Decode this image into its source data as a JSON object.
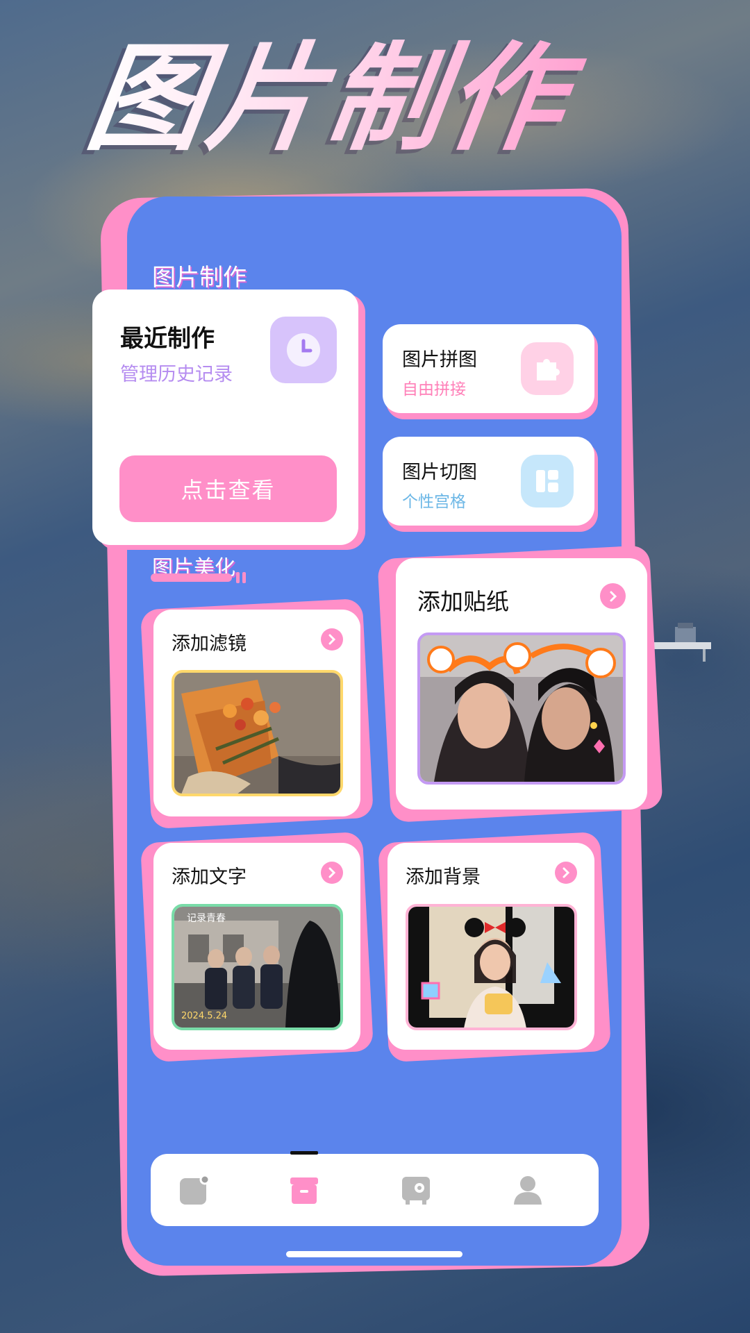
{
  "hero": {
    "title": "图片制作"
  },
  "colors": {
    "accent_pink": "#ff8fc8",
    "panel_blue": "#5b84ec",
    "purple_text": "#b58cf0",
    "blue_text": "#6cb7e6"
  },
  "sections": {
    "make": {
      "title": "图片制作"
    },
    "beautify": {
      "title": "图片美化"
    }
  },
  "recent": {
    "title": "最近制作",
    "subtitle": "管理历史记录",
    "button_label": "点击查看",
    "icon": "clock-icon"
  },
  "collage": {
    "title": "图片拼图",
    "subtitle": "自由拼接",
    "icon": "puzzle-icon"
  },
  "cut": {
    "title": "图片切图",
    "subtitle": "个性宫格",
    "icon": "grid-icon"
  },
  "beautify_cards": [
    {
      "title": "添加滤镜",
      "icon": "chevron-right-icon"
    },
    {
      "title": "添加贴纸",
      "icon": "chevron-right-icon"
    },
    {
      "title": "添加文字",
      "icon": "chevron-right-icon",
      "photo_caption": "记录青春",
      "photo_date": "2024.5.24"
    },
    {
      "title": "添加背景",
      "icon": "chevron-right-icon"
    }
  ],
  "tabbar": {
    "tabs": [
      {
        "icon": "image-icon",
        "active": false
      },
      {
        "icon": "box-icon",
        "active": true
      },
      {
        "icon": "safe-icon",
        "active": false
      },
      {
        "icon": "person-icon",
        "active": false
      }
    ]
  }
}
